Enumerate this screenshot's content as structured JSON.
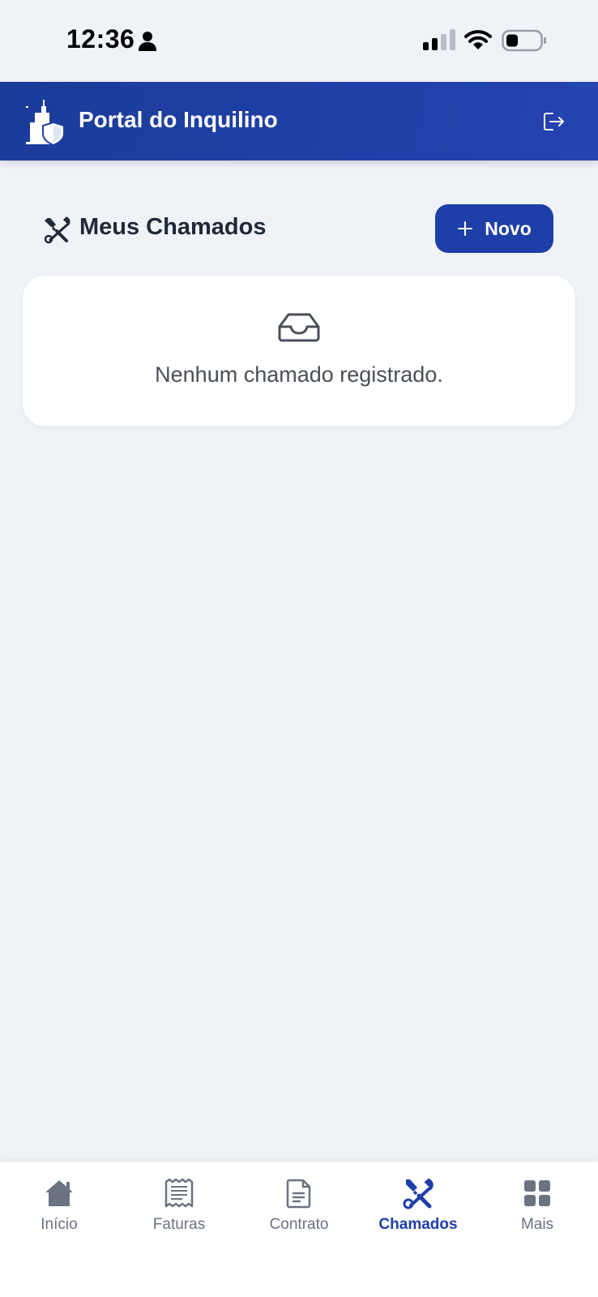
{
  "status_bar": {
    "time": "12:36"
  },
  "header": {
    "title": "Portal do Inquilino",
    "logo_icon": "building-shield-icon",
    "logout_icon": "logout-icon"
  },
  "section": {
    "icon": "tools-icon",
    "title": "Meus Chamados",
    "new_button_label": "Novo"
  },
  "empty_state": {
    "icon": "inbox-icon",
    "message": "Nenhum chamado registrado."
  },
  "bottom_nav": {
    "items": [
      {
        "label": "Início",
        "icon": "home-icon",
        "active": false
      },
      {
        "label": "Faturas",
        "icon": "receipt-icon",
        "active": false
      },
      {
        "label": "Contrato",
        "icon": "document-icon",
        "active": false
      },
      {
        "label": "Chamados",
        "icon": "tools-icon",
        "active": true
      },
      {
        "label": "Mais",
        "icon": "grid-icon",
        "active": false
      }
    ]
  },
  "colors": {
    "primary": "#1e3fa8",
    "background": "#eff2f7",
    "inactive_nav": "#6b7280"
  }
}
